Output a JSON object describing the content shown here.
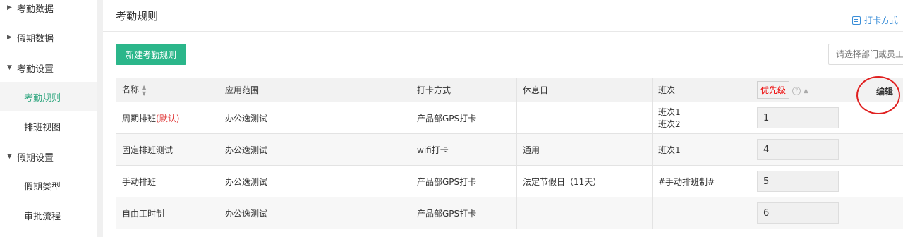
{
  "sidebar": {
    "groups": [
      {
        "label": "考勤数据",
        "expanded": false
      },
      {
        "label": "假期数据",
        "expanded": false
      },
      {
        "label": "考勤设置",
        "expanded": true
      },
      {
        "label": "假期设置",
        "expanded": true
      }
    ],
    "sub_items": {
      "rules": "考勤规则",
      "schedule_view": "排班视图",
      "leave_type": "假期类型",
      "approval_flow": "审批流程"
    },
    "active": "考勤规则"
  },
  "header": {
    "title": "考勤规则",
    "clock_link": "打卡方式"
  },
  "toolbar": {
    "new_rule_label": "新建考勤规则",
    "search_placeholder": "请选择部门或员工"
  },
  "table": {
    "headers": {
      "name": "名称",
      "scope": "应用范围",
      "clock": "打卡方式",
      "rest": "休息日",
      "shift": "班次",
      "priority": "优先级",
      "edit": "编辑"
    },
    "rows": [
      {
        "name": "周期排班",
        "tag": "(默认)",
        "scope": "办公逸测试",
        "clock": "产品部GPS打卡",
        "rest": "",
        "shift": [
          "班次1",
          "班次2"
        ],
        "priority": "1"
      },
      {
        "name": "固定排班测试",
        "tag": "",
        "scope": "办公逸测试",
        "clock": "wifi打卡",
        "rest": "通用",
        "shift": [
          "班次1"
        ],
        "priority": "4"
      },
      {
        "name": "手动排班",
        "tag": "",
        "scope": "办公逸测试",
        "clock": "产品部GPS打卡",
        "rest": "法定节假日（11天）",
        "shift": [
          "#手动排班制#"
        ],
        "priority": "5"
      },
      {
        "name": "自由工时制",
        "tag": "",
        "scope": "办公逸测试",
        "clock": "产品部GPS打卡",
        "rest": "",
        "shift": [],
        "priority": "6"
      }
    ]
  },
  "colors": {
    "accent": "#2bb68a",
    "link": "#3a8ed8",
    "highlight": "#e02020"
  }
}
